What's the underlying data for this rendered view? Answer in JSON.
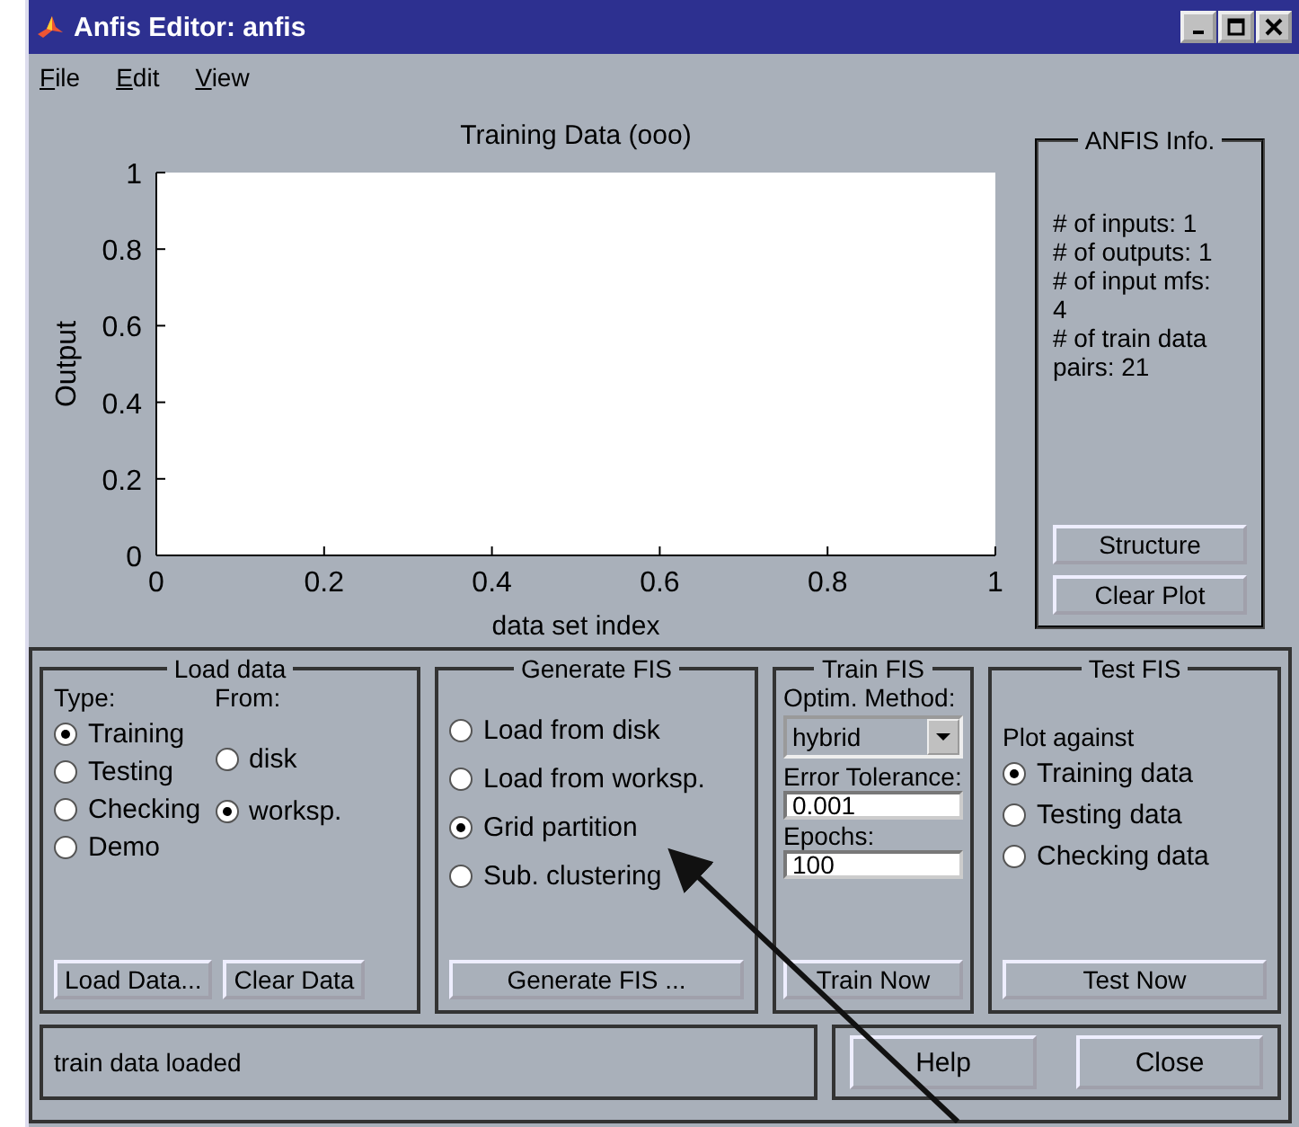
{
  "window": {
    "title": "Anfis Editor: anfis"
  },
  "menu": [
    {
      "label": "File"
    },
    {
      "label": "Edit"
    },
    {
      "label": "View"
    }
  ],
  "plot": {
    "chart_data": {
      "type": "line",
      "title": "Training Data (ooo)",
      "xlabel": "data set index",
      "ylabel": "Output",
      "xlim": [
        0,
        1
      ],
      "ylim": [
        0,
        1
      ],
      "xticks": [
        0,
        0.2,
        0.4,
        0.6,
        0.8,
        1
      ],
      "yticks": [
        0,
        0.2,
        0.4,
        0.6,
        0.8,
        1
      ]
    }
  },
  "info": {
    "title": "ANFIS Info.",
    "lines": [
      "# of inputs: 1",
      "# of outputs: 1",
      "# of input mfs:",
      "4",
      "# of train data",
      "pairs: 21"
    ],
    "buttons": [
      "Structure",
      "Clear Plot"
    ]
  },
  "load_data": {
    "title": "Load data",
    "type_label": "Type:",
    "from_label": "From:",
    "types": [
      {
        "label": "Training",
        "selected": true
      },
      {
        "label": "Testing",
        "selected": false
      },
      {
        "label": "Checking",
        "selected": false
      },
      {
        "label": "Demo",
        "selected": false
      }
    ],
    "sources": [
      {
        "label": "disk",
        "selected": false
      },
      {
        "label": "worksp.",
        "selected": true
      }
    ],
    "buttons": [
      "Load Data...",
      "Clear Data"
    ]
  },
  "generate_fis": {
    "title": "Generate FIS",
    "options": [
      {
        "label": "Load from disk",
        "selected": false
      },
      {
        "label": "Load from worksp.",
        "selected": false
      },
      {
        "label": "Grid partition",
        "selected": true
      },
      {
        "label": "Sub. clustering",
        "selected": false
      }
    ],
    "button": "Generate FIS ..."
  },
  "train_fis": {
    "title": "Train FIS",
    "method_label": "Optim. Method:",
    "method": "hybrid",
    "tolerance_label": "Error Tolerance:",
    "tolerance": "0.001",
    "epochs_label": "Epochs:",
    "epochs": "100",
    "button": "Train Now"
  },
  "test_fis": {
    "title": "Test FIS",
    "plot_label": "Plot against",
    "options": [
      {
        "label": "Training data",
        "selected": true
      },
      {
        "label": "Testing data",
        "selected": false
      },
      {
        "label": "Checking data",
        "selected": false
      }
    ],
    "button": "Test Now"
  },
  "status": {
    "message": "train data loaded",
    "buttons": [
      "Help",
      "Close"
    ]
  }
}
